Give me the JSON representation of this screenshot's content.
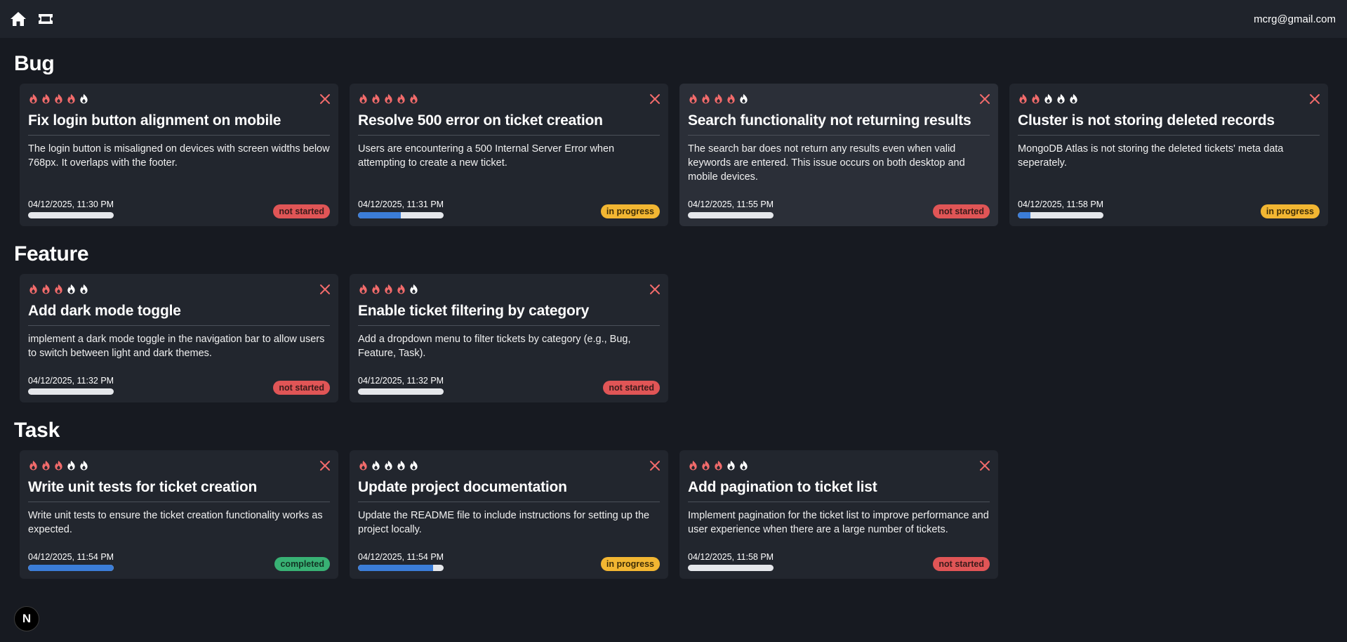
{
  "header": {
    "user_email": "mcrg@gmail.com"
  },
  "colors": {
    "flame_active": "#f26b6b",
    "flame_inactive": "#ffffff",
    "progress_fill": "#3b7dd8",
    "not_started": "#e05556",
    "in_progress": "#f2b632",
    "completed": "#38b174"
  },
  "sections": [
    {
      "title": "Bug",
      "tickets": [
        {
          "priority": 4,
          "title": "Fix login button alignment on mobile",
          "description": "The login button is misaligned on devices with screen widths below 768px. It overlaps with the footer.",
          "date": "04/12/2025, 11:30 PM",
          "progress": 0,
          "status": "not started"
        },
        {
          "priority": 5,
          "title": "Resolve 500 error on ticket creation",
          "description": "Users are encountering a 500 Internal Server Error when attempting to create a new ticket.",
          "date": "04/12/2025, 11:31 PM",
          "progress": 0.5,
          "status": "in progress"
        },
        {
          "priority": 4,
          "title": "Search functionality not returning results",
          "description": "The search bar does not return any results even when valid keywords are entered. This issue occurs on both desktop and mobile devices.",
          "date": "04/12/2025, 11:55 PM",
          "progress": 0,
          "status": "not started"
        },
        {
          "priority": 2,
          "title": "Cluster is not storing deleted records",
          "description": "MongoDB Atlas is not storing the deleted tickets' meta data seperately.",
          "date": "04/12/2025, 11:58 PM",
          "progress": 0.15,
          "status": "in progress"
        }
      ]
    },
    {
      "title": "Feature",
      "tickets": [
        {
          "priority": 3,
          "title": "Add dark mode toggle",
          "description": "implement a dark mode toggle in the navigation bar to allow users to switch between light and dark themes.",
          "date": "04/12/2025, 11:32 PM",
          "progress": 0,
          "status": "not started"
        },
        {
          "priority": 4,
          "title": "Enable ticket filtering by category",
          "description": "Add a dropdown menu to filter tickets by category (e.g., Bug, Feature, Task).",
          "date": "04/12/2025, 11:32 PM",
          "progress": 0,
          "status": "not started"
        }
      ]
    },
    {
      "title": "Task",
      "tickets": [
        {
          "priority": 3,
          "title": "Write unit tests for ticket creation",
          "description": "Write unit tests to ensure the ticket creation functionality works as expected.",
          "date": "04/12/2025, 11:54 PM",
          "progress": 1,
          "status": "completed"
        },
        {
          "priority": 1,
          "title": "Update project documentation",
          "description": "Update the README file to include instructions for setting up the project locally.",
          "date": "04/12/2025, 11:54 PM",
          "progress": 0.88,
          "status": "in progress"
        },
        {
          "priority": 3,
          "title": "Add pagination to ticket list",
          "description": "Implement pagination for the ticket list to improve performance and user experience when there are a large number of tickets.",
          "date": "04/12/2025, 11:58 PM",
          "progress": 0,
          "status": "not started"
        }
      ]
    }
  ],
  "badge": {
    "label": "N"
  }
}
